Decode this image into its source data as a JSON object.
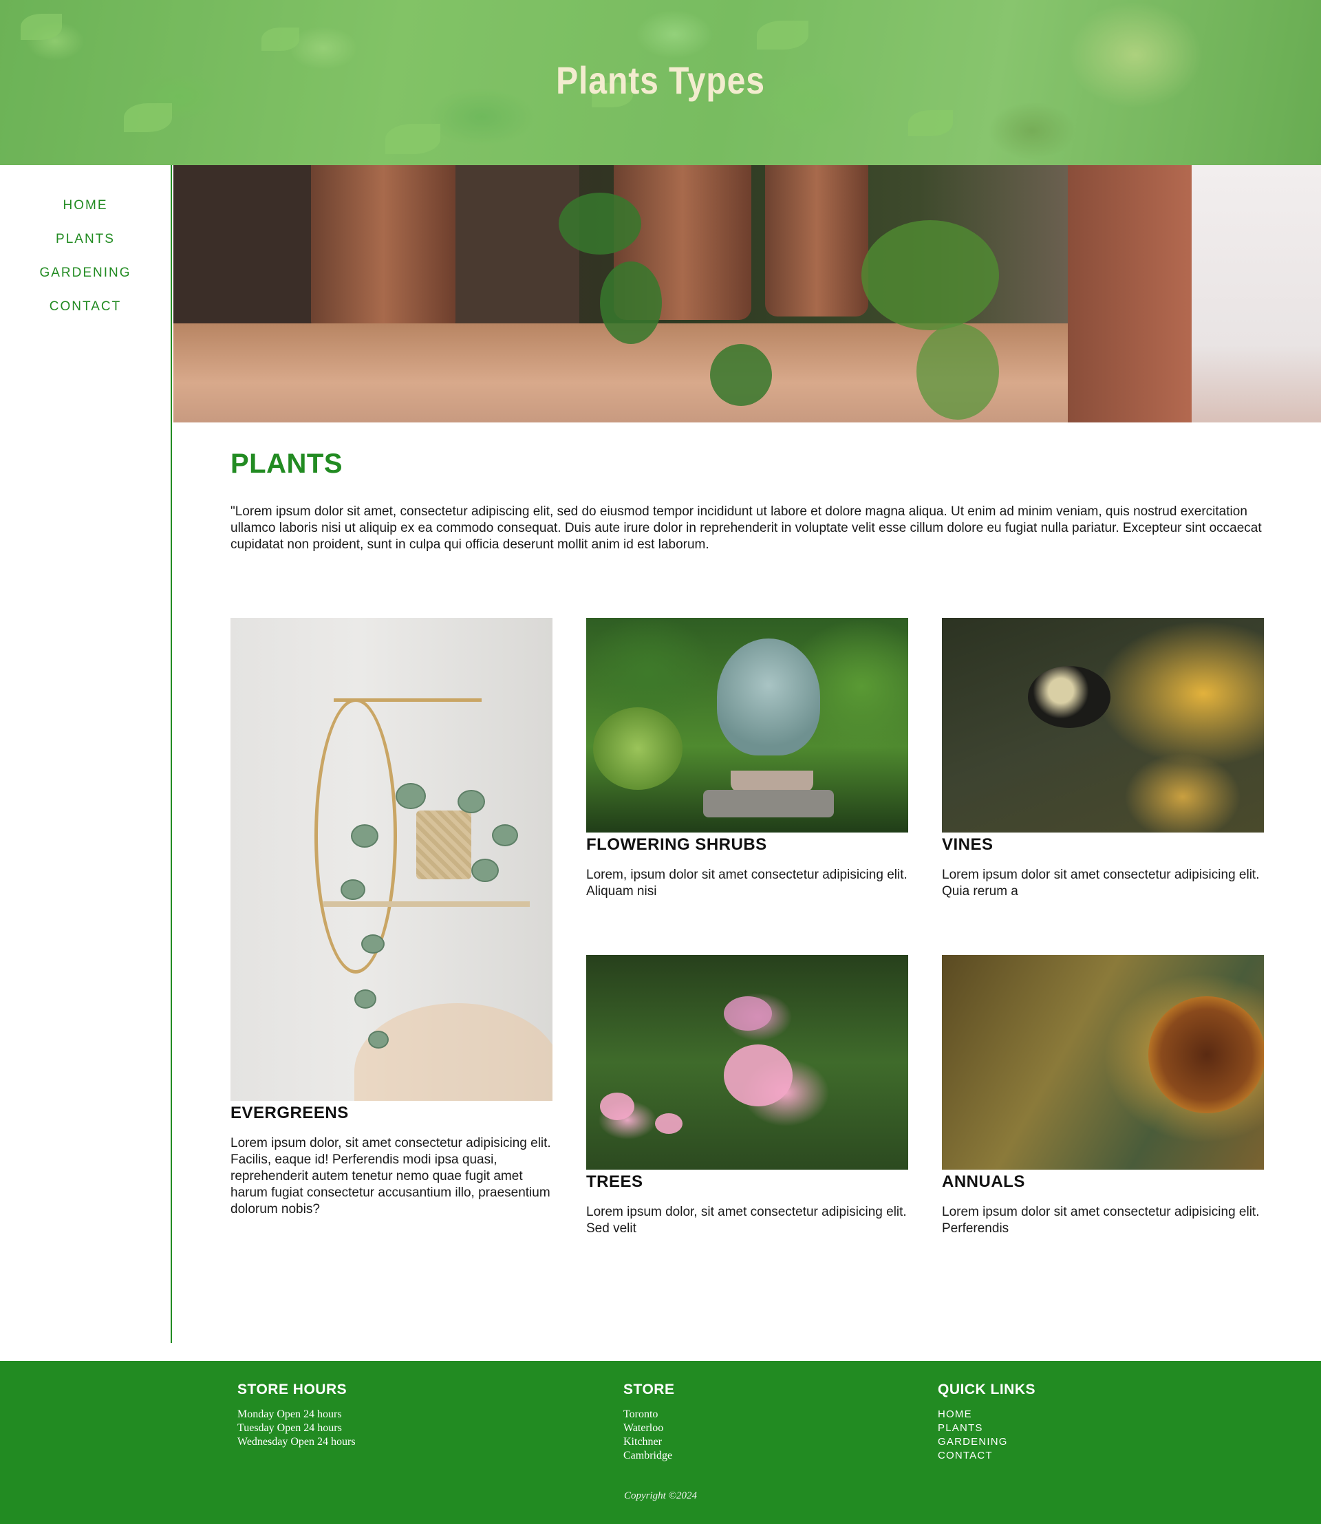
{
  "header": {
    "title": "Plants Types"
  },
  "nav": {
    "items": [
      {
        "label": "HOME"
      },
      {
        "label": "PLANTS"
      },
      {
        "label": "GARDENING"
      },
      {
        "label": "CONTACT"
      }
    ]
  },
  "main": {
    "title": "PLANTS",
    "intro": "\"Lorem ipsum dolor sit amet, consectetur adipiscing elit, sed do eiusmod tempor incididunt ut labore et dolore magna aliqua. Ut enim ad minim veniam, quis nostrud exercitation ullamco laboris nisi ut aliquip ex ea commodo consequat. Duis aute irure dolor in reprehenderit in voluptate velit esse cillum dolore eu fugiat nulla pariatur. Excepteur sint occaecat cupidatat non proident, sunt in culpa qui officia deserunt mollit anim id est laborum.",
    "cards": [
      {
        "title": "EVERGREENS",
        "text": "Lorem ipsum dolor, sit amet consectetur adipisicing elit. Facilis, eaque id! Perferendis modi ipsa quasi, reprehenderit autem tenetur nemo quae fugit amet harum fugiat consectetur accusantium illo, praesentium dolorum nobis?"
      },
      {
        "title": "FLOWERING SHRUBS",
        "text": "Lorem, ipsum dolor sit amet consectetur adipisicing elit. Aliquam nisi"
      },
      {
        "title": "VINES",
        "text": "Lorem ipsum dolor sit amet consectetur adipisicing elit. Quia rerum a"
      },
      {
        "title": "TREES",
        "text": "Lorem ipsum dolor, sit amet consectetur adipisicing elit. Sed velit"
      },
      {
        "title": "ANNUALS",
        "text": "Lorem ipsum dolor sit amet consectetur adipisicing elit. Perferendis"
      }
    ]
  },
  "footer": {
    "store_hours": {
      "title": "STORE HOURS",
      "lines": [
        "Monday Open 24 hours",
        "Tuesday Open 24 hours",
        "Wednesday Open 24 hours"
      ]
    },
    "store": {
      "title": "STORE",
      "lines": [
        "Toronto",
        "Waterloo",
        "Kitchner",
        "Cambridge"
      ]
    },
    "quick_links": {
      "title": "QUICK LINKS",
      "links": [
        "HOME",
        "PLANTS",
        "GARDENING",
        "CONTACT"
      ]
    },
    "copyright": "Copyright ©2024"
  },
  "colors": {
    "accent": "#228b22",
    "header_title": "#f3eccf",
    "text": "#1a1a1a"
  }
}
